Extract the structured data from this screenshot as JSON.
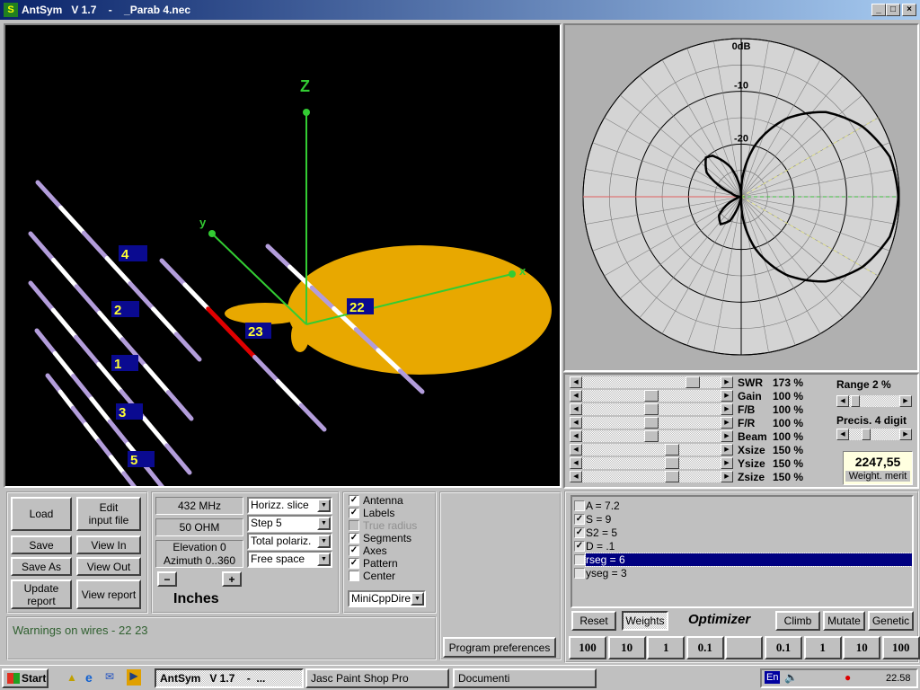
{
  "window": {
    "title": "AntSym   V 1.7    -    _Parab 4.nec",
    "min": "_",
    "max": "□",
    "close": "×"
  },
  "view3d": {
    "axis_labels": {
      "z": "Z",
      "y": "y",
      "x": "x"
    },
    "wire_labels": [
      "4",
      "2",
      "1",
      "3",
      "5",
      "23",
      "22"
    ],
    "colors": {
      "wire": "#b39ddb",
      "segment": "#ffffff",
      "warning_wire": "#e00000",
      "axes": "#33cc33",
      "pattern": "#e8a800",
      "label_bg": "#0a0a90",
      "label_text": "#ffff33"
    }
  },
  "polar": {
    "ring_labels": [
      "0dB",
      "-10",
      "-20"
    ],
    "range_db": 30,
    "chart_data": {
      "type": "polar-line",
      "title": "",
      "ring_labels": [
        "0dB",
        "-10",
        "-20"
      ],
      "r_range_db": [
        -30,
        0
      ],
      "ring_step_db": 5,
      "spoke_step_deg": 10,
      "pattern": [
        [
          0,
          -0.2
        ],
        [
          15,
          -0.8
        ],
        [
          30,
          -3.4
        ],
        [
          45,
          -7.3
        ],
        [
          60,
          -12.9
        ],
        [
          75,
          -19.9
        ],
        [
          85,
          -25.7
        ],
        [
          92,
          -30
        ],
        [
          110,
          -24
        ],
        [
          125,
          -20.5
        ],
        [
          132,
          -20
        ],
        [
          145,
          -22
        ],
        [
          160,
          -28
        ],
        [
          180,
          -30
        ],
        [
          200,
          -29
        ],
        [
          220,
          -24.5
        ],
        [
          233,
          -23.5
        ],
        [
          245,
          -25
        ],
        [
          258,
          -30
        ],
        [
          268,
          -30
        ],
        [
          275,
          -25.7
        ],
        [
          285,
          -19.9
        ],
        [
          300,
          -12.9
        ],
        [
          315,
          -7.3
        ],
        [
          330,
          -3.4
        ],
        [
          345,
          -0.8
        ]
      ]
    }
  },
  "sliders": [
    {
      "label": "SWR",
      "value": "173 %",
      "pos": 0.83
    },
    {
      "label": "Gain",
      "value": "100 %",
      "pos": 0.5
    },
    {
      "label": "F/B",
      "value": "100 %",
      "pos": 0.5
    },
    {
      "label": "F/R",
      "value": "100 %",
      "pos": 0.5
    },
    {
      "label": "Beam",
      "value": "100 %",
      "pos": 0.5
    },
    {
      "label": "Xsize",
      "value": "150 %",
      "pos": 0.67
    },
    {
      "label": "Ysize",
      "value": "150 %",
      "pos": 0.67
    },
    {
      "label": "Zsize",
      "value": "150 %",
      "pos": 0.67
    }
  ],
  "range": {
    "label": "Range 2 %",
    "pos": 0.05
  },
  "precision": {
    "label": "Precis. 4 digit",
    "pos": 0.35
  },
  "merit": {
    "value": "2247,55",
    "label": "Weight. merit"
  },
  "file_buttons": {
    "load": "Load",
    "edit": "Edit\ninput file",
    "save": "Save",
    "view_in": "View In",
    "save_as": "Save As",
    "view_out": "View Out",
    "update": "Update\nreport",
    "view_report": "View report"
  },
  "params": {
    "freq": "432 MHz",
    "impedance": "50 OHM",
    "elevation": "Elevation 0",
    "azimuth": "Azimuth 0..360",
    "minus": "−",
    "plus": "+",
    "units": "Inches"
  },
  "dropdowns": [
    "Horizz. slice",
    "Step 5",
    "Total polariz.",
    "Free space"
  ],
  "display_options": [
    {
      "label": "Antenna",
      "checked": true,
      "enabled": true
    },
    {
      "label": "Labels",
      "checked": true,
      "enabled": true
    },
    {
      "label": "True radius",
      "checked": false,
      "enabled": false
    },
    {
      "label": "Segments",
      "checked": true,
      "enabled": true
    },
    {
      "label": "Axes",
      "checked": true,
      "enabled": true
    },
    {
      "label": "Pattern",
      "checked": true,
      "enabled": true
    },
    {
      "label": "Center",
      "checked": false,
      "enabled": true
    }
  ],
  "engine": "MiniCppDirect",
  "warnings": "Warnings on wires - 22 23",
  "preferences": "Program preferences",
  "variables": [
    {
      "label": "A = 7.2",
      "checked": false
    },
    {
      "label": "S = 9",
      "checked": true
    },
    {
      "label": "S2 = 5",
      "checked": true
    },
    {
      "label": "D = .1",
      "checked": true
    },
    {
      "label": "rseg = 6",
      "checked": false,
      "selected": true
    },
    {
      "label": "yseg = 3",
      "checked": false
    }
  ],
  "optimizer": {
    "reset": "Reset",
    "weights": "Weights",
    "title": "Optimizer",
    "climb": "Climb",
    "mutate": "Mutate",
    "genetic": "Genetic"
  },
  "steps": [
    "100",
    "10",
    "1",
    "0.1",
    "",
    "0.1",
    "1",
    "10",
    "100"
  ],
  "taskbar": {
    "start": "Start",
    "tasks": [
      "AntSym   V 1.7    -  ...",
      "Jasc Paint Shop Pro",
      "Documenti"
    ],
    "lang": "En",
    "clock": "22.58"
  }
}
